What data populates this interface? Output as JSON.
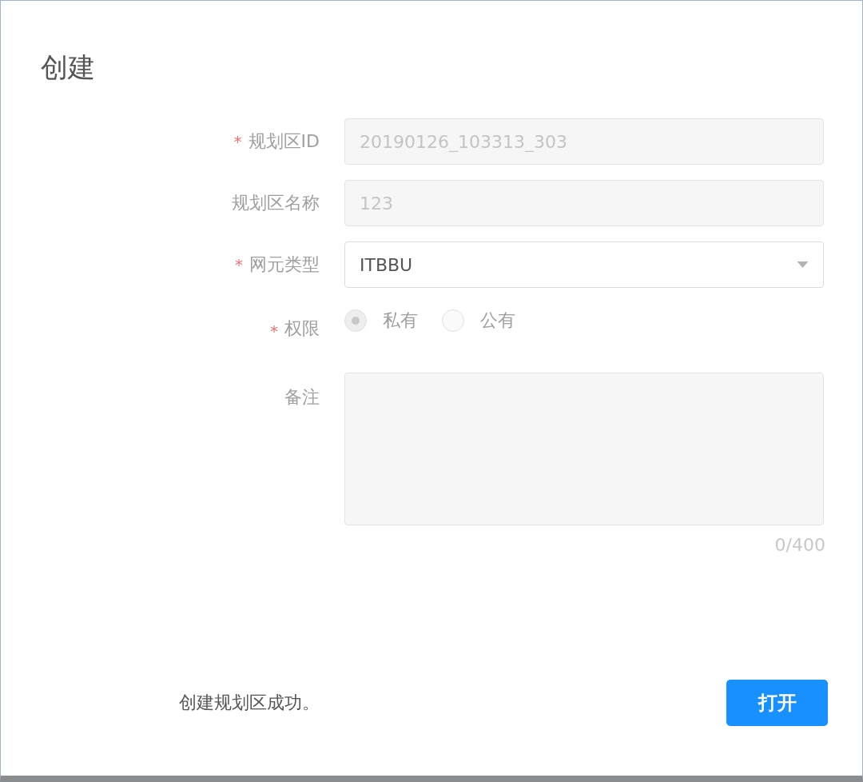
{
  "dialog": {
    "title": "创建"
  },
  "fields": [
    {
      "kind": "text",
      "required_mark": "*",
      "label": "规划区ID",
      "value": "20190126_103313_303",
      "disabled": true
    },
    {
      "kind": "text",
      "label": "规划区名称",
      "value": "123",
      "disabled": true
    },
    {
      "kind": "select",
      "required_mark": "*",
      "label": "网元类型",
      "value": "ITBBU",
      "disabled": false
    },
    {
      "kind": "radio",
      "required_mark": "*",
      "label": "权限",
      "disabled": true,
      "options": [
        {
          "label": "私有",
          "selected": true
        },
        {
          "label": "公有",
          "selected": false
        }
      ]
    },
    {
      "kind": "textarea",
      "label": "备注",
      "counter": "0/400"
    }
  ],
  "footer": {
    "message": "创建规划区成功。",
    "button": "打开"
  }
}
